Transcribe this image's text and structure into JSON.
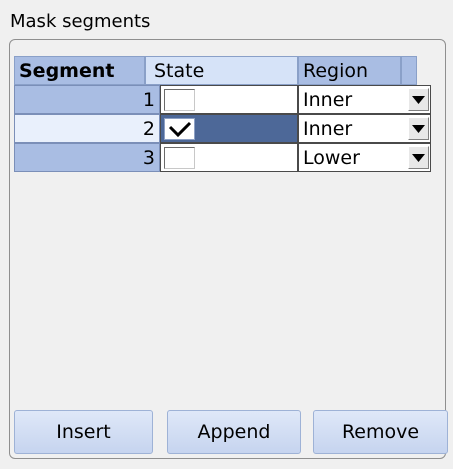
{
  "group": {
    "title": "Mask segments"
  },
  "table": {
    "headers": {
      "segment": "Segment",
      "state": "State",
      "region": "Region"
    },
    "rows": [
      {
        "segment": "1",
        "state_checked": false,
        "region": "Inner",
        "selected": false
      },
      {
        "segment": "2",
        "state_checked": true,
        "region": "Inner",
        "selected": true
      },
      {
        "segment": "3",
        "state_checked": false,
        "region": "Lower",
        "selected": false
      }
    ]
  },
  "buttons": {
    "insert": "Insert",
    "append": "Append",
    "remove": "Remove"
  },
  "colors": {
    "header_blue": "#a9bde3",
    "selected_state": "#4d6898",
    "button_top": "#dfe8f8",
    "button_bottom": "#c6d4ef"
  },
  "icons": {
    "checkbox_mark": "checkmark-icon",
    "dropdown": "chevron-down-icon"
  }
}
